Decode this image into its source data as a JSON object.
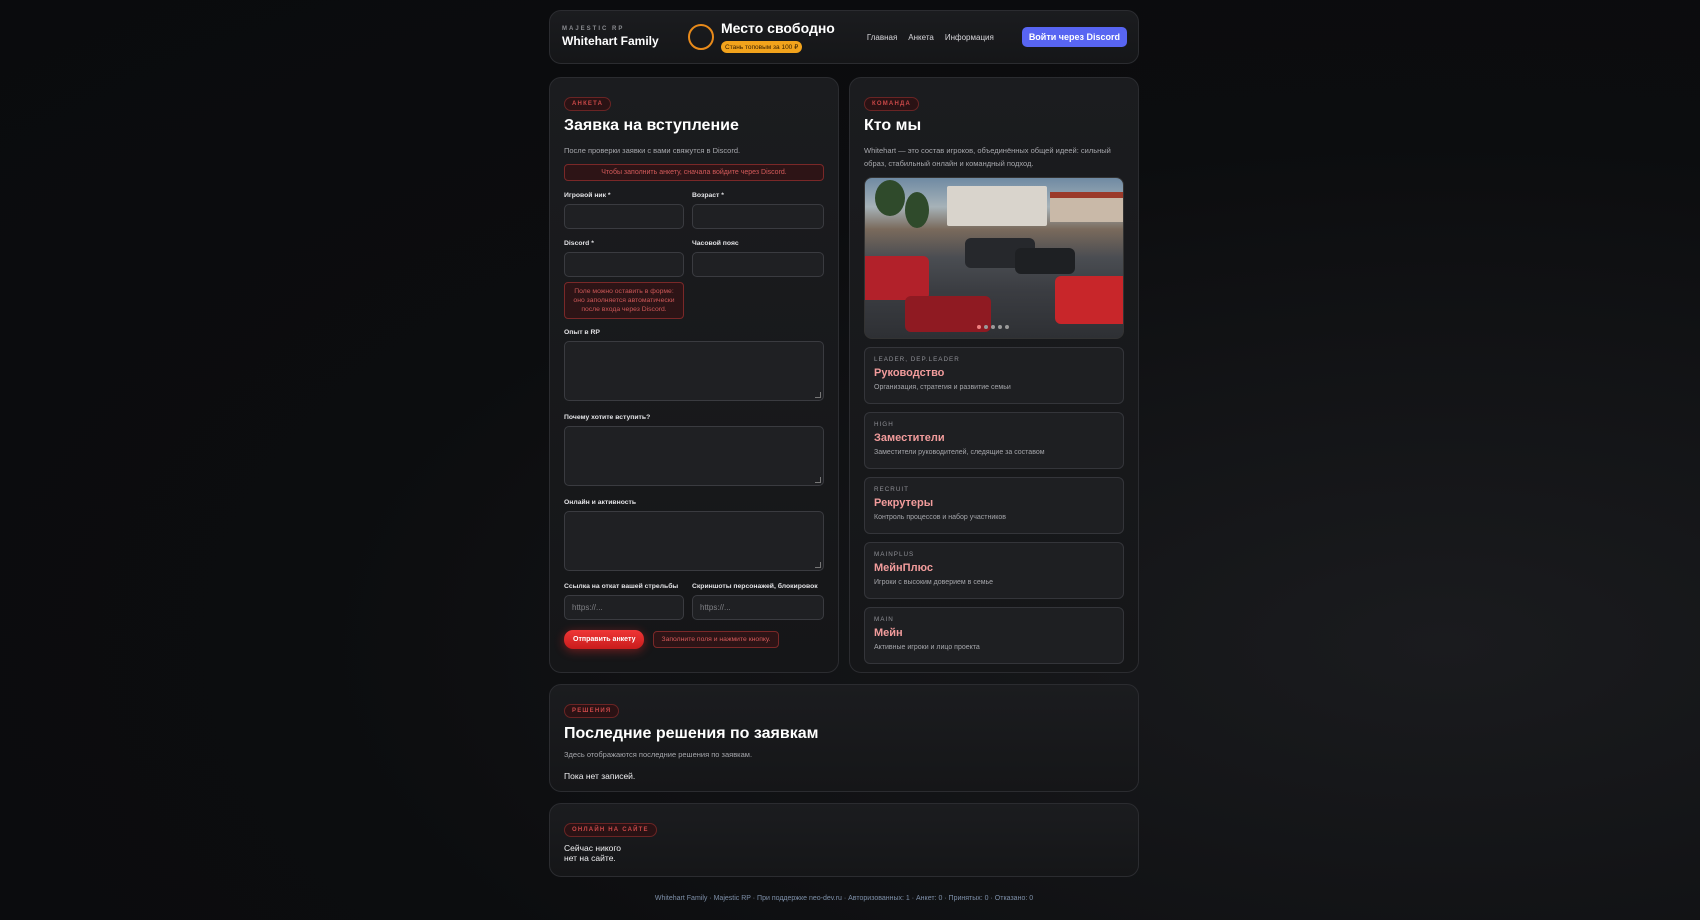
{
  "header": {
    "brand_small": "MAJESTIC RP",
    "brand_name": "Whitehart Family",
    "slot_title": "Место свободно",
    "slot_badge": "Стань топовым за 100 ₽",
    "nav": [
      "Главная",
      "Анкета",
      "Информация"
    ],
    "login_button": "Войти через Discord",
    "colors": {
      "accent": "#5865f2",
      "ring": "#e88a1a",
      "badge": "#f2a31c"
    }
  },
  "form": {
    "tag": "АНКЕТА",
    "title": "Заявка на вступление",
    "subtitle": "После проверки заявки с вами свяжутся в Discord.",
    "login_alert": "Чтобы заполнить анкету, сначала войдите через Discord.",
    "nick_label": "Игровой ник *",
    "age_label": "Возраст *",
    "discord_label": "Discord *",
    "timezone_label": "Часовой пояс",
    "discord_hint": "Поле можно оставить в форме: оно заполняется автоматически после входа через Discord.",
    "rp_label": "Опыт в RP",
    "why_label": "Почему хотите вступить?",
    "online_label": "Онлайн и активность",
    "shooting_label": "Ссылка на откат вашей стрельбы",
    "screens_label": "Скриншоты персонажей, блокировок",
    "shooting_placeholder": "https://...",
    "screens_placeholder": "https://...",
    "submit": "Отправить анкету",
    "submit_note": "Заполните поля и нажмите кнопку."
  },
  "about": {
    "tag": "КОМАНДА",
    "title": "Кто мы",
    "subtitle": "Whitehart — это состав игроков, объединённых общей идеей: сильный образ, стабильный онлайн и командный подход.",
    "carousel": {
      "slides": 5,
      "active": 1
    },
    "roles": [
      {
        "tag": "LEADER, DEP.LEADER",
        "name": "Руководство",
        "desc": "Организация, стратегия и развитие семьи"
      },
      {
        "tag": "HIGH",
        "name": "Заместители",
        "desc": "Заместители руководителей, следящие за составом"
      },
      {
        "tag": "RECRUIT",
        "name": "Рекрутеры",
        "desc": "Контроль процессов и набор участников"
      },
      {
        "tag": "MAINPLUS",
        "name": "МейнПлюс",
        "desc": "Игроки с высоким доверием в семье"
      },
      {
        "tag": "MAIN",
        "name": "Мейн",
        "desc": "Активные игроки и лицо проекта"
      }
    ]
  },
  "decisions": {
    "tag": "РЕШЕНИЯ",
    "title": "Последние решения по заявкам",
    "subtitle": "Здесь отображаются последние решения по заявкам.",
    "empty": "Пока нет записей."
  },
  "online": {
    "tag": "ОНЛАЙН НА САЙТЕ",
    "text": "Сейчас никого нет на сайте."
  },
  "footer": "Whitehart Family · Majestic RP · При поддержке neo-dev.ru · Авторизованных: 1 · Анкет: 0 · Принятых: 0 · Отказано: 0"
}
